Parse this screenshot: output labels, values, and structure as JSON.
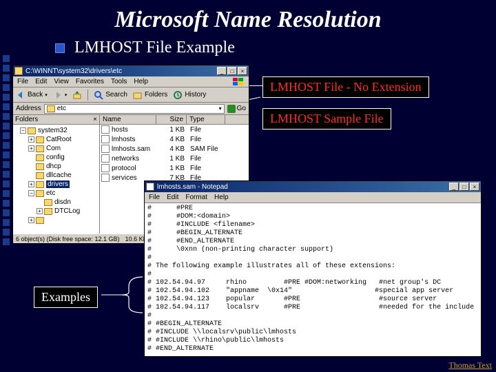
{
  "slide": {
    "title": "Microsoft Name Resolution",
    "subtitle": "LMHOST File    Example",
    "footer": "Thomas Text"
  },
  "callouts": {
    "noext": "LMHOST File - No Extension",
    "sample": "LMHOST Sample File",
    "examples": "Examples"
  },
  "explorer": {
    "title": "C:\\WINNT\\system32\\drivers\\etc",
    "menu": [
      "File",
      "Edit",
      "View",
      "Favorites",
      "Tools",
      "Help"
    ],
    "toolbar": {
      "back": "Back",
      "search": "Search",
      "folders": "Folders",
      "history": "History"
    },
    "address_label": "Address",
    "address": "etc",
    "go": "Go",
    "folders_header": "Folders",
    "tree": [
      "system32",
      "CatRoot",
      "Com",
      "config",
      "dhcp",
      "dllcache",
      "drivers",
      "etc",
      "disdn",
      "DTCLog",
      " "
    ],
    "columns": [
      "Name",
      "Size",
      "Type"
    ],
    "files": [
      {
        "name": "hosts",
        "size": "1 KB",
        "type": "File"
      },
      {
        "name": "lmhosts",
        "size": "4 KB",
        "type": "File"
      },
      {
        "name": "lmhosts.sam",
        "size": "4 KB",
        "type": "SAM File"
      },
      {
        "name": "networks",
        "size": "1 KB",
        "type": "File"
      },
      {
        "name": "protocol",
        "size": "1 KB",
        "type": "File"
      },
      {
        "name": "services",
        "size": "7 KB",
        "type": "File"
      }
    ],
    "status": [
      "6 object(s) (Disk free space: 12.1 GB)",
      "10.6 KB"
    ]
  },
  "notepad": {
    "title": "lmhosts.sam - Notepad",
    "menu": [
      "File",
      "Edit",
      "Format",
      "Help"
    ],
    "content": "#      #PRE\n#      #DOM:<domain>\n#      #INCLUDE <filename>\n#      #BEGIN_ALTERNATE\n#      #END_ALTERNATE\n#      \\0xnn (non-printing character support)\n#\n# The following example illustrates all of these extensions:\n#\n# 102.54.94.97     rhino         #PRE #DOM:networking   #net group's DC\n# 102.54.94.102    \"appname  \\0x14\"                    #special app server\n# 102.54.94.123    popular       #PRE                   #source server\n# 102.54.94.117    localsrv      #PRE                   #needed for the include\n#\n# #BEGIN_ALTERNATE\n# #INCLUDE \\\\localsrv\\public\\lmhosts\n# #INCLUDE \\\\rhino\\public\\lmhosts\n# #END_ALTERNATE"
  }
}
